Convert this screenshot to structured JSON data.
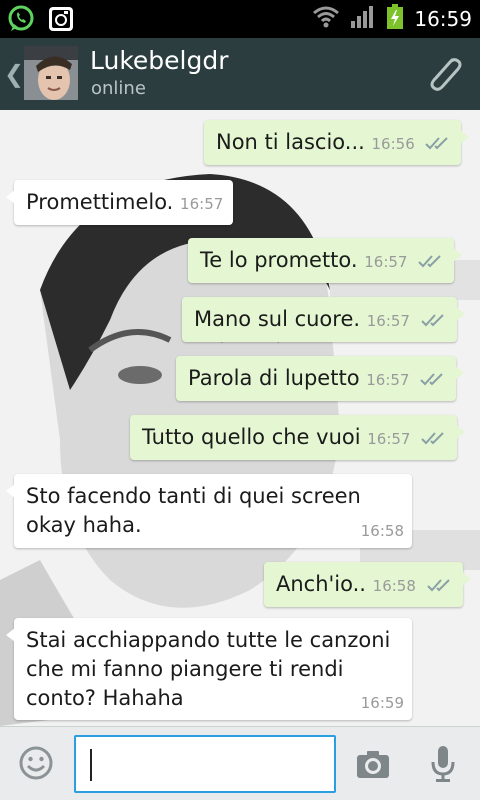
{
  "status_bar": {
    "time": "16:59",
    "icons": [
      "whatsapp-icon",
      "instagram-icon",
      "wifi-icon",
      "signal-icon",
      "battery-charging-icon"
    ]
  },
  "header": {
    "contact_name": "Lukebelgdr",
    "contact_status": "online",
    "icons": [
      "back-chevron-icon",
      "attach-paperclip-icon"
    ]
  },
  "messages": [
    {
      "dir": "out",
      "text": "Non ti lascio...",
      "time": "16:56"
    },
    {
      "dir": "in",
      "text": "Promettimelo.",
      "time": "16:57"
    },
    {
      "dir": "out",
      "text": "Te lo prometto.",
      "time": "16:57"
    },
    {
      "dir": "out",
      "text": "Mano sul cuore.",
      "time": "16:57"
    },
    {
      "dir": "out",
      "text": "Parola di lupetto",
      "time": "16:57"
    },
    {
      "dir": "out",
      "text": "Tutto quello che vuoi",
      "time": "16:57"
    },
    {
      "dir": "in",
      "text_line1": "Sto facendo tanti di quei screen",
      "text_line2": "okay haha.",
      "time": "16:58"
    },
    {
      "dir": "out",
      "text": "Anch'io..",
      "time": "16:58"
    },
    {
      "dir": "in",
      "text_line1": "Stai acchiappando tutte le canzoni",
      "text_line2": "che mi fanno piangere ti rendi",
      "text_line3": "conto? Hahaha",
      "time": "16:59"
    }
  ],
  "input_bar": {
    "value": "",
    "icons": [
      "emoji-icon",
      "camera-icon",
      "microphone-icon"
    ]
  },
  "colors": {
    "header_bg": "#2b3d3f",
    "outgoing_bubble": "#e4f7d2",
    "incoming_bubble": "#ffffff",
    "input_focus": "#2a9ee0",
    "read_ticks": "#8aa0a6"
  }
}
